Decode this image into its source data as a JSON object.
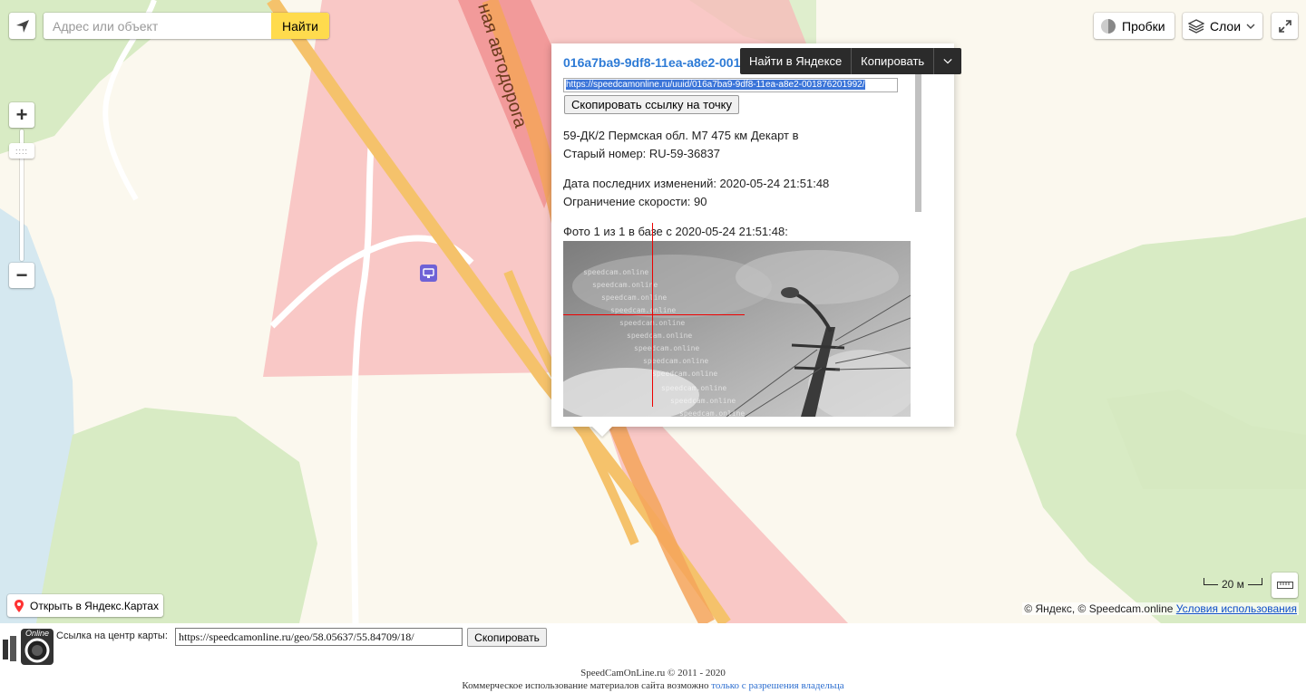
{
  "search": {
    "placeholder": "Адрес или объект",
    "button_label": "Найти"
  },
  "map_controls": {
    "traffic_label": "Пробки",
    "layers_label": "Слои",
    "open_yandex_label": "Открыть в Яндекс.Картах",
    "scale_label": "20 м"
  },
  "map_labels": {
    "road_name": "ная автодорога"
  },
  "copyright": {
    "text": "© Яндекс, © Speedcam.online",
    "terms_link": "Условия использования"
  },
  "balloon": {
    "title": "016a7ba9-9df8-11ea-a8e2-001",
    "uuid_url": "https://speedcamonline.ru/uuid/016a7ba9-9df8-11ea-a8e2-001876201992/",
    "copy_point_button": "Скопировать ссылку на точку",
    "location_line": "59-ДК/2 Пермская обл. М7 475 км Декарт в",
    "old_number_line": "Старый номер: RU-59-36837",
    "last_changed_line": "Дата последних изменений: 2020-05-24 21:51:48",
    "speed_limit_line": "Ограничение скорости: 90",
    "photo_caption": "Фото 1 из 1 в базе с 2020-05-24 21:51:48:",
    "photo_watermark": "speedcam.online"
  },
  "context_toolbar": {
    "find_label": "Найти в Яндексе",
    "copy_label": "Копировать"
  },
  "link_row": {
    "label": "Ссылка на центр карты:",
    "url": "https://speedcamonline.ru/geo/58.05637/55.84709/18/",
    "copy_button": "Скопировать"
  },
  "footer": {
    "line1": "SpeedCamOnLine.ru © 2011 - 2020",
    "line2_prefix": "Коммерческое использование материалов сайта возможно",
    "line2_link": "только с разрешения владельца"
  },
  "colors": {
    "search_button": "#ffdb4d",
    "camera_zone": "#f8b8b8",
    "road": "#f5c26b",
    "link": "#2e7bd6"
  }
}
